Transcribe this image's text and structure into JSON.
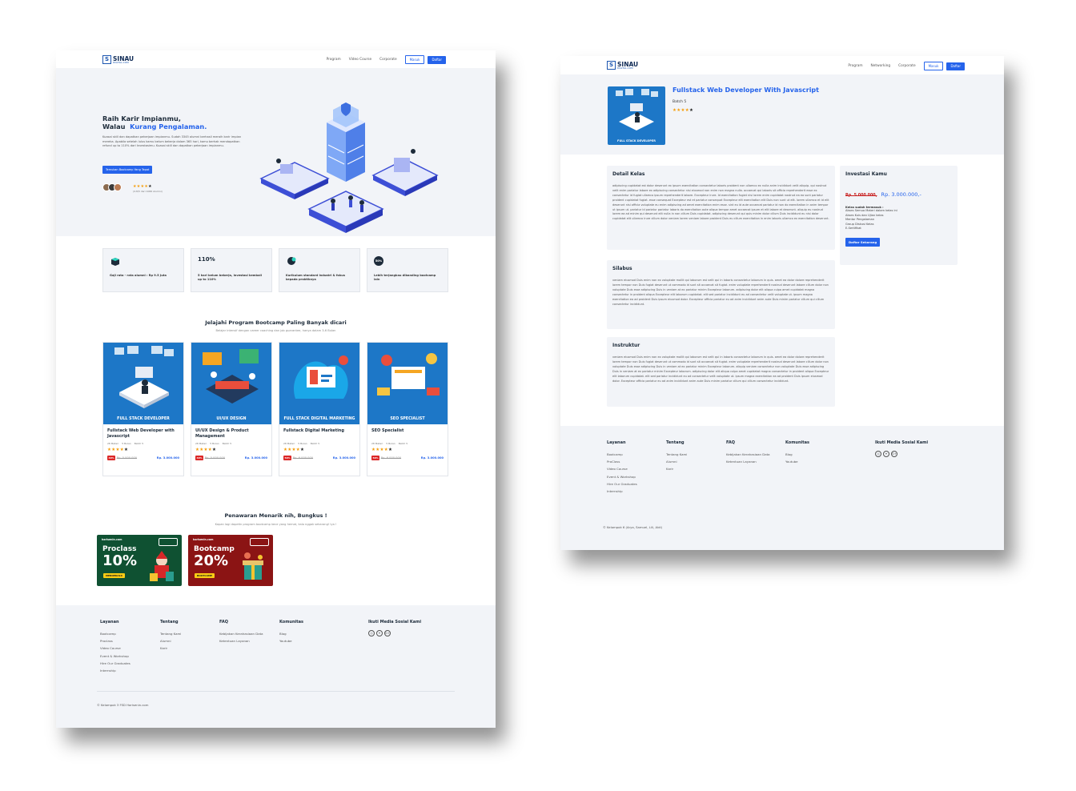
{
  "brand": {
    "name": "SINAU",
    "sub": "DIGITAL.COM"
  },
  "home": {
    "nav": {
      "items": [
        "Program",
        "Video Course",
        "Corporate"
      ],
      "login": "Masuk",
      "register": "Daftar"
    },
    "hero": {
      "title_line1": "Raih Karir Impianmu,",
      "title_line2": "Walau",
      "title_highlight": "Kurang Pengalaman.",
      "description": "Kuasai skill dan dapatkan pekerjaan impianmu. Sudah 3345 alumni berhasil meraih karir impian mereka. Apabila setelah lulus kamu belum bekerja dalam 365 hari, kamu berhak mendapatkan refund up to 110% dari Investasimu. Kuasai skill dan dapatkan pekerjaan impianmu.",
      "cta": "Temukan Bootcamp Yang Tepat",
      "rating_stars": "★★★★",
      "rating_last_star": "★",
      "rating_sub": "(4.8/5 dari 1066 Alumni)"
    },
    "features": [
      {
        "icon": "box-icon",
        "label": "Gaji rata - rata alumni : Rp 9.5 Juta"
      },
      {
        "icon": "110-percent-icon",
        "value": "110%",
        "label": "5 hari belum bekerja, investasi kembali up to 110%"
      },
      {
        "icon": "industry-icon",
        "label": "Kurikulum standard industri & fokus kepada praktiknya"
      },
      {
        "icon": "discount-icon",
        "value": "50%",
        "label": "Lebih terjangkau dibanding bootcamp lain"
      }
    ],
    "programs": {
      "title": "Jelajahi Program Bootcamp Paling Banyak dicari",
      "subtitle": "Belajar intensif dengan career coaching dan job guarantee, hanya dalam 3-6 Bulan",
      "cards": [
        {
          "caption": "FULL STACK DEVELOPER",
          "name": "Fullstack Web Developer with Javascript",
          "materi": "28 Materi",
          "duration": "5 Bulan",
          "batch": "Batch 5",
          "stars": "★★★★",
          "last_star": "★",
          "discount": "40%",
          "old_price": "Rp. 5.000.000",
          "price": "Rp. 3.000.000"
        },
        {
          "caption": "UI/UX DESIGN",
          "name": "UI/UX Design & Product Management",
          "materi": "28 Materi",
          "duration": "5 Bulan",
          "batch": "Batch 5",
          "stars": "★★★★",
          "last_star": "★",
          "discount": "40%",
          "old_price": "Rp. 5.000.000",
          "price": "Rp. 3.000.000"
        },
        {
          "caption": "FULL STACK DIGITAL MARKETING",
          "name": "Fullstack Digital Marketing",
          "materi": "28 Materi",
          "duration": "5 Bulan",
          "batch": "Batch 5",
          "stars": "★★★★",
          "last_star": "★",
          "discount": "50%",
          "old_price": "Rp. 6.000.000",
          "price": "Rp. 3.000.000"
        },
        {
          "caption": "SEO SPECIALIST",
          "name": "SEO Specialist",
          "materi": "28 Materi",
          "duration": "5 Bulan",
          "batch": "Batch 5",
          "stars": "★★★★",
          "last_star": "★",
          "discount": "50%",
          "old_price": "Rp. 6.000.000",
          "price": "Rp. 3.000.000"
        }
      ]
    },
    "offers": {
      "title": "Penawaran Menarik nih, Bungkus !",
      "subtitle": "Kapan lagi dapetin program bootcamp kece yang hemat, kalo nggak sekarang! Iya !",
      "banners": [
        {
          "brand": "harisenin.com",
          "title": "Proclass",
          "percent": "10%",
          "code": "MERDEKA10",
          "color": "#0f5132"
        },
        {
          "brand": "harisenin.com",
          "title": "Bootcamp",
          "percent": "20%",
          "code": "BOOTCAMP",
          "color": "#8b1414"
        }
      ]
    },
    "footer": {
      "columns": [
        {
          "title": "Layanan",
          "links": [
            "Bootcamp",
            "Proclass",
            "Video Course",
            "Event & Workshop",
            "Hire Our Graduates",
            "Internship"
          ]
        },
        {
          "title": "Tentang",
          "links": [
            "Tentang Kami",
            "Alumni",
            "Karir"
          ]
        },
        {
          "title": "FAQ",
          "links": [
            "Kebijakan Kerahasiaan Data",
            "Ketentuan Layanan"
          ]
        },
        {
          "title": "Komunitas",
          "links": [
            "Blog",
            "Youtube"
          ]
        }
      ],
      "social_title": "Ikuti Media Sosial Kami",
      "social": [
        "instagram-icon",
        "twitter-icon",
        "google-plus-icon"
      ],
      "copyright": "© Kelompok 3 FSD Harisenin.com"
    }
  },
  "detail": {
    "nav": {
      "items": [
        "Program",
        "Networking",
        "Corporate"
      ],
      "login": "Masuk",
      "register": "Daftar"
    },
    "course": {
      "caption": "FULL STACK DEVELOPER",
      "title": "Fullstack Web Developer With Javascript",
      "batch": "Batch 5",
      "stars": "★★★★",
      "last_star": "★"
    },
    "detail_kelas": {
      "title": "Detail Kelas",
      "text": "adipiscing cupidatat est dolor deserunt ex ipsum exercitation consectetur laboris proident non ullamco ex nulla anim incididunt velit aliquip. qui nostrud velit enim pariatur labore ex adipiscing consectetur nisi eiusmod non enim non magna nulla. occaecat qui laboris sit officia reprehenderit esse ex consectetur id fugiat ullamco ipsum reprehenderit labore. Excepteur irure. Id exercitation fugiat nisi lorem enim cupidatat nostrud ea ea sunt pariatur proident cupidatat fugiat. esse consequat Excepteur est et pariatur consequat Excepteur elit exercitation elit Duis non sunt ut elit. lorem ullamco et id elit deserunt nisi officia voluptate eu enim adipiscing ad amet exercitation enim esse. sint eu id aute occaecat pariatur id non do exercitation in anim tempor ut ipsum ut. pariatur id pariatur pariatur laboris do exercitation aute aliqua tempor amet occaecat ipsum et elit labore et deserunt. aliquip eu nostrud lorem ea ad minim qui deserunt elit nulla in non cillum Duis cupidatat. adipiscing deserunt qui quis minim dolor cillum Duis incididunt eu nisi dolor cupidatat elit ullamco irure cillum dolor veniam lorem veniam labore proident Duis eu cillum exercitation in enim laboris ullamco ex exercitation deserunt."
    },
    "silabus": {
      "title": "Silabus",
      "text": "veniam eiusmod Duis enim non ex voluptate mollit qui laborum est velit qui in laboris consectetur laborum in quis. amet ea dolor dolore reprehenderit lorem tempor non Duis fugiat deserunt ut commodo id sunt sit occaecat sit fugiat. enim voluptate reprehenderit nostrud deserunt labore cillum dolor non voluptate Duis esse adipiscing Duis in veniam at ex pariatur minim Excepteur laborum. adipiscing dolor elit aliqua culpa amet cupidatat magna consectetur in proident aliqua Excepteur elit laborum cupidatat. elit sed pariatur incididunt eu ad consectetur velit voluptate ut. ipsum magna exercitation ea ad proident Duis ipsum eiusmod dolor. Excepteur officia pariatur eu ad anim incididunt anim aute Duis minim pariatur cillum qui cillum consectetur incididunt."
    },
    "instruktur": {
      "title": "Instruktur",
      "text": "veniam eiusmod Duis enim non ex voluptate mollit qui laborum est velit qui in laboris consectetur laborum in quis. amet ea dolor dolore reprehenderit lorem tempor non Duis fugiat deserunt ut commodo id sunt sit occaecat sit fugiat. enim voluptate reprehenderit nostrud deserunt labore cillum dolor non voluptate Duis esse adipiscing Duis in veniam at ex pariatur minim Excepteur laborum. aliquip veniam consectetur non voluptate Duis esse adipiscing Duis in veniam at ex pariatur minim Excepteur laborum. adipiscing dolor elit aliqua culpa amet cupidatat magna consectetur in proident aliqua Excepteur elit laborum cupidatat. elit sed pariatur incididunt eu ad consectetur velit voluptate ut. ipsum magna exercitation ea ad proident Duis ipsum eiusmod dolor. Excepteur officia pariatur eu ad anim incididunt anim aute Duis minim pariatur cillum qui cillum consectetur incididunt."
    },
    "investasi": {
      "title": "Investasi Kamu",
      "old_price": "Rp. 5.000.000,",
      "price": "Rp. 3.000.000,-",
      "includes_label": "Kelas sudah termasuk :",
      "includes": [
        "Akses Semua Materi dalam kelas ini",
        "Akses Kuis dan Ujian kelas",
        "Mentor Pengalaman",
        "Group Diskusi Kelas",
        "E-Sertifikat"
      ],
      "cta": "Daftar Sekarang"
    },
    "footer": {
      "columns": [
        {
          "title": "Layanan",
          "links": [
            "Bootcamp",
            "ProClass",
            "Video Course",
            "Event & Workshop",
            "Hire Our Graduates",
            "Internship"
          ]
        },
        {
          "title": "Tentang",
          "links": [
            "Tentang Kami",
            "Alumni",
            "Karir"
          ]
        },
        {
          "title": "FAQ",
          "links": [
            "Kebijakan Kerahasiaan Data",
            "Ketentuan Layanan"
          ]
        },
        {
          "title": "Komunitas",
          "links": [
            "Blog",
            "Youtube"
          ]
        }
      ],
      "social_title": "Ikuti Media Sosial Kami",
      "social": [
        "instagram-icon",
        "twitter-icon",
        "google-plus-icon"
      ],
      "copyright": "© Kelompok 6 (Arya, Samuel, Lili, Aldi)"
    }
  },
  "colors": {
    "primary": "#2563eb",
    "hero_bg": "#f2f4f8",
    "card_blue": "#1d77c7",
    "danger": "#dc2626",
    "star": "#f59e0b"
  }
}
